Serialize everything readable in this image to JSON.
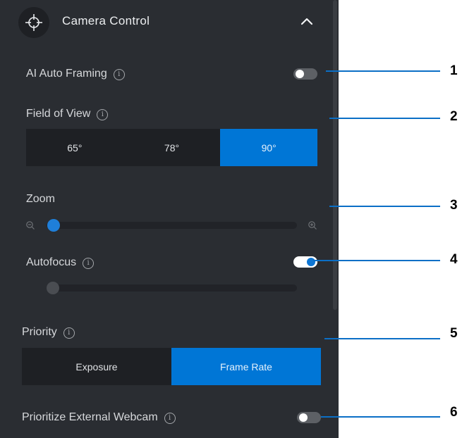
{
  "header": {
    "title": "Camera Control"
  },
  "ai_auto_framing": {
    "label": "AI Auto Framing",
    "enabled": false
  },
  "field_of_view": {
    "label": "Field of View",
    "options": [
      "65°",
      "78°",
      "90°"
    ],
    "selected": "90°"
  },
  "zoom": {
    "label": "Zoom",
    "value_fraction": 0.0
  },
  "autofocus": {
    "label": "Autofocus",
    "enabled": true,
    "focus_fraction": 0.0
  },
  "priority": {
    "label": "Priority",
    "options": [
      "Exposure",
      "Frame Rate"
    ],
    "selected": "Frame Rate"
  },
  "prioritize_external_webcam": {
    "label": "Prioritize External Webcam",
    "enabled": false
  },
  "info_glyph": "i",
  "callouts": [
    "1",
    "2",
    "3",
    "4",
    "5",
    "6"
  ],
  "colors": {
    "panel": "#2a2d32",
    "accent": "#0076d6",
    "segment_bg": "#1e2024",
    "callout_line": "#0b6fc6"
  },
  "icons": {
    "header": "crosshair-icon",
    "collapse": "chevron-up-icon",
    "info": "info-icon",
    "zoom_out": "zoom-out-icon",
    "zoom_in": "zoom-in-icon"
  }
}
